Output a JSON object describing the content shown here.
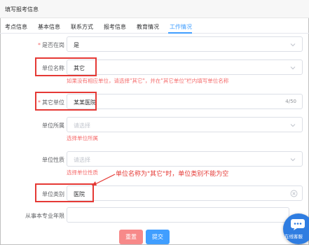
{
  "page": {
    "title": "填写报考信息"
  },
  "tabs": [
    {
      "label": "考点信息"
    },
    {
      "label": "基本信息"
    },
    {
      "label": "联系方式"
    },
    {
      "label": "报考信息"
    },
    {
      "label": "教育情况"
    },
    {
      "label": "工作情况"
    }
  ],
  "active_tab": "工作情况",
  "form": {
    "on_job": {
      "label": "是否在岗",
      "value": "是"
    },
    "unit_name": {
      "label": "单位名称",
      "value": "其它",
      "hint": "如果没有相应单位，请选择\"其它\"，并在\"其它单位\"栏内填写单位名称"
    },
    "other_unit": {
      "label": "其它单位",
      "value": "某某医院",
      "counter": "4/50"
    },
    "unit_affiliation": {
      "label": "单位所属",
      "placeholder": "请选择",
      "error": "选择单位所属"
    },
    "unit_nature": {
      "label": "单位性质",
      "placeholder": "请选择",
      "error": "选择单位性质"
    },
    "unit_category": {
      "label": "单位类别",
      "value": "医院"
    },
    "years_in_profession": {
      "label": "从事本专业年限"
    }
  },
  "annotation": {
    "text": "单位名称为\"其它\"时，单位类别不能为空"
  },
  "buttons": {
    "reset": "重置",
    "submit": "提交"
  },
  "chat": {
    "label": "在线客服"
  },
  "colors": {
    "primary": "#409eff",
    "error": "#f56c6c",
    "annotation": "#e53935"
  }
}
